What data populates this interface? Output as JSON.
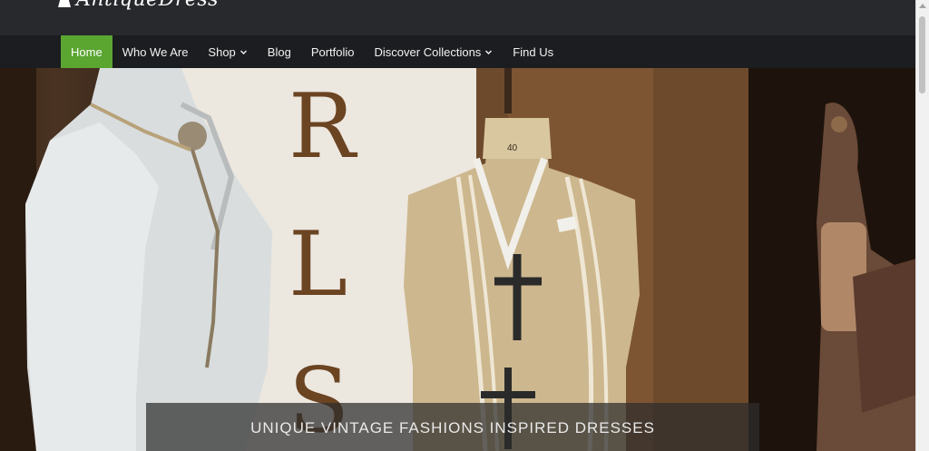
{
  "header": {
    "logo_text": "AntiqueDress"
  },
  "nav": {
    "items": [
      {
        "label": "Home",
        "active": true,
        "has_dropdown": false
      },
      {
        "label": "Who We Are",
        "active": false,
        "has_dropdown": false
      },
      {
        "label": "Shop",
        "active": false,
        "has_dropdown": true
      },
      {
        "label": "Blog",
        "active": false,
        "has_dropdown": false
      },
      {
        "label": "Portfolio",
        "active": false,
        "has_dropdown": false
      },
      {
        "label": "Discover Collections",
        "active": false,
        "has_dropdown": true
      },
      {
        "label": "Find Us",
        "active": false,
        "has_dropdown": false
      }
    ]
  },
  "hero": {
    "caption": "UNIQUE VINTAGE FASHIONS INSPIRED DRESSES",
    "window_letters": [
      "R",
      "L",
      "S"
    ],
    "mannequin_tag": "40"
  },
  "colors": {
    "accent": "#5ba531",
    "nav_bg": "#1b1d20",
    "header_bg": "#27292c"
  }
}
